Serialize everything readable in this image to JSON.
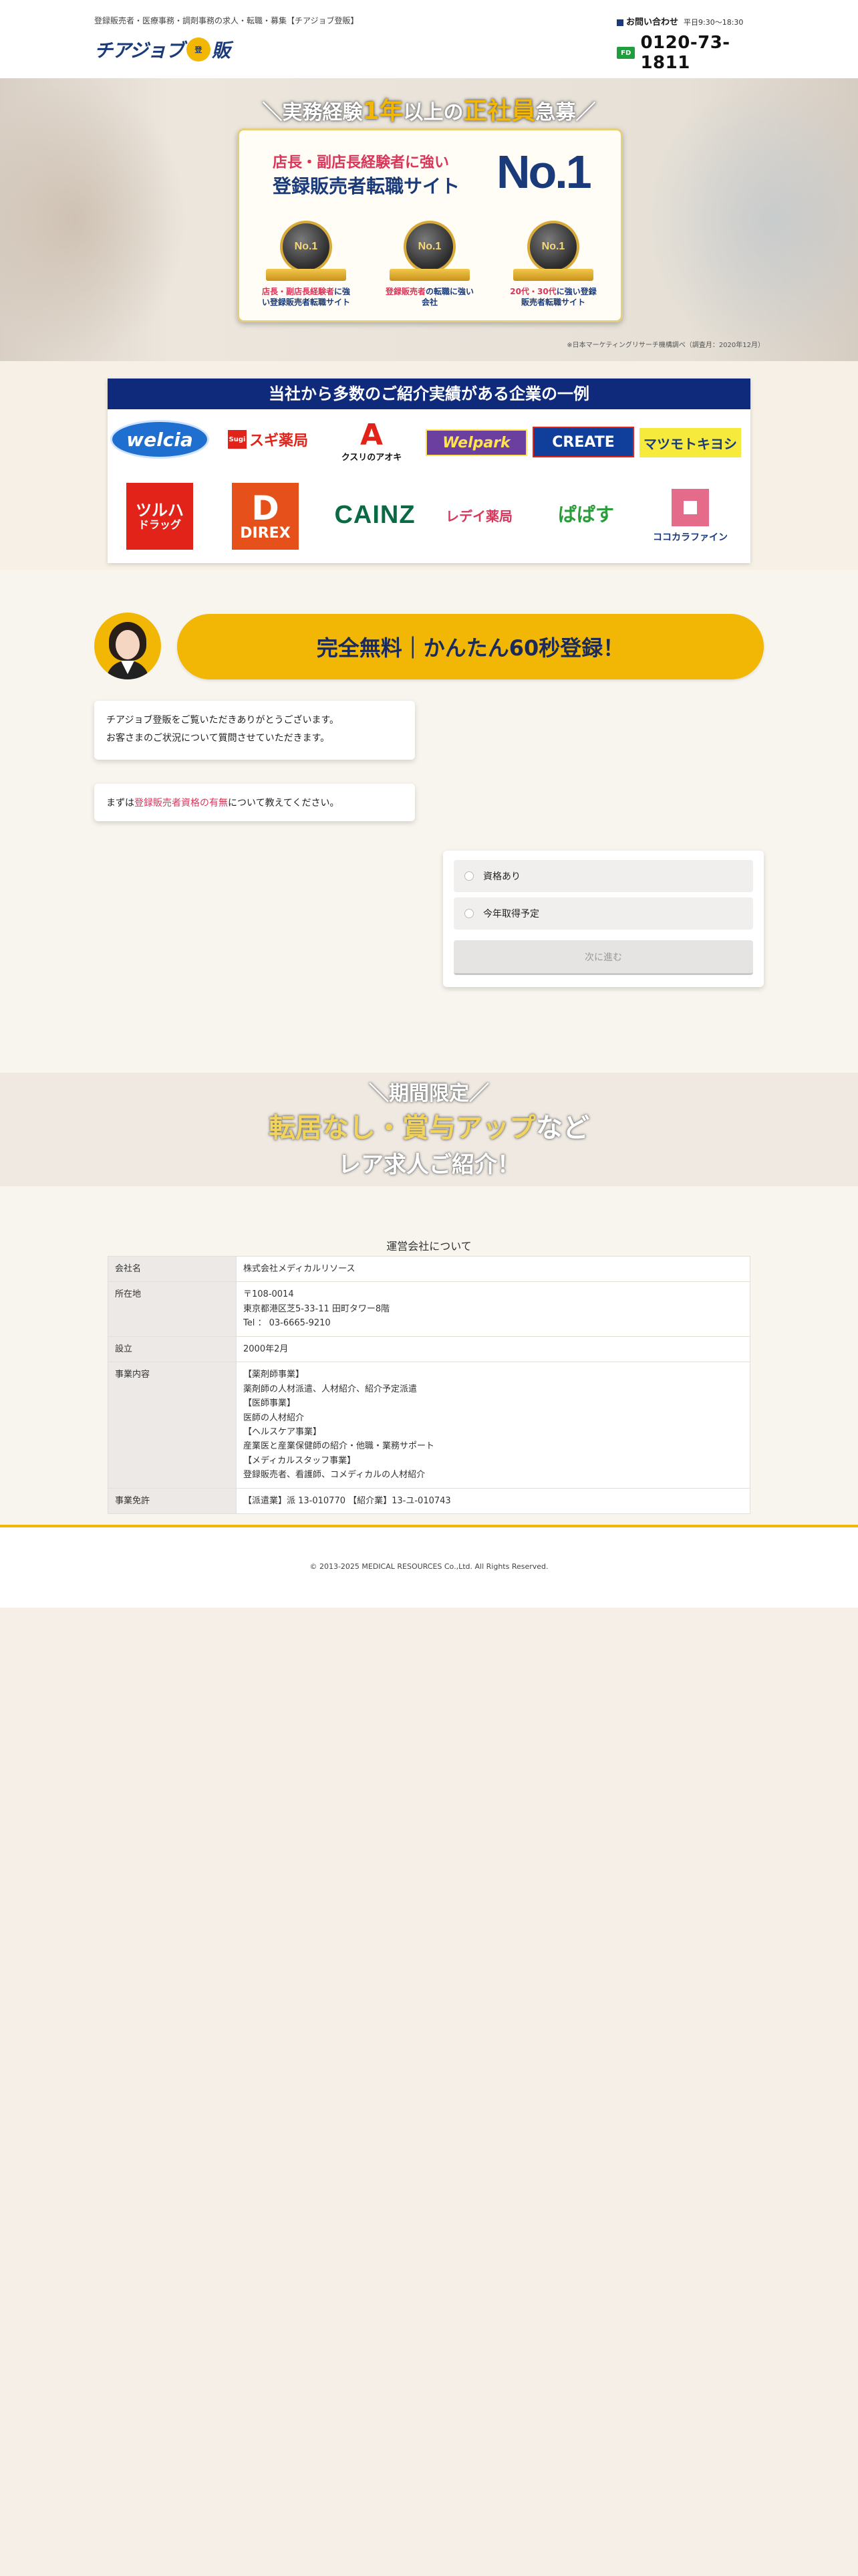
{
  "header": {
    "tagline": "登録販売者・医療事務・調剤事務の求人・転職・募集【チアジョブ登販】",
    "logo_text": "チアジョブ",
    "logo_badge": "登",
    "logo_han": "販",
    "contact_title": "お問い合わせ",
    "contact_hours": "平日9:30〜18:30",
    "tel_icon": "FD",
    "tel": "0120-73-1811"
  },
  "hero": {
    "headline_pre": "＼実務経験",
    "headline_hl1": "1年",
    "headline_mid": "以上の",
    "headline_hl2": "正社員",
    "headline_post": "急募／",
    "card_line1": "店長・副店長経験者に強い",
    "card_line2": "登録販売者転職サイト",
    "card_big": "No.1",
    "medals": [
      {
        "label": "No.1",
        "cap_red": "店長・副店長経験者",
        "cap_rest": "に強い登録販売者転職サイト"
      },
      {
        "label": "No.1",
        "cap_red": "登録販売者",
        "cap_rest": "の転職に強い会社"
      },
      {
        "label": "No.1",
        "cap_red": "20代・30代",
        "cap_rest": "に強い登録販売者転職サイト"
      }
    ],
    "note": "※日本マーケティングリサーチ機構調べ（調査月：2020年12月）"
  },
  "companies": {
    "title": "当社から多数のご紹介実績がある企業の一例",
    "logos": {
      "welcia": "welcia",
      "sugi_box": "Sugi",
      "sugi": "スギ薬局",
      "aoki_mark": "A",
      "aoki": "クスリのアオキ",
      "welpark": "Welpark",
      "create": "CREATE",
      "matsukiyo": "マツモトキヨシ",
      "tsuruha_1": "ツルハ",
      "tsuruha_2": "ドラッグ",
      "direx_mark": "D",
      "direx": "DIREX",
      "cainz": "CAINZ",
      "lady": "レデイ薬局",
      "papasu": "ぱぱす",
      "kokokara": "ココカラファイン"
    }
  },
  "chat": {
    "cta": "完全無料｜かんたん60秒登録！",
    "bubble1_line1": "チアジョブ登販をご覧いただきありがとうございます。",
    "bubble1_line2": "お客さまのご状況について質問させていただきます。",
    "bubble2_pre": "まずは",
    "bubble2_pink": "登録販売者資格の有無",
    "bubble2_post": "について教えてください。",
    "options": [
      "資格あり",
      "今年取得予定"
    ],
    "next": "次に進む"
  },
  "limited": {
    "line1": "＼期間限定／",
    "line2_hl": "転居なし・賞与アップ",
    "line2_post": "など",
    "line3": "レア求人ご紹介！"
  },
  "company_info": {
    "title": "運営会社について",
    "rows": {
      "name_k": "会社名",
      "name_v": "株式会社メディカルリソース",
      "addr_k": "所在地",
      "addr_v1": "〒108-0014",
      "addr_v2": "東京都港区芝5-33-11 田町タワー8階",
      "addr_v3": "Tel ： 03-6665-9210",
      "est_k": "設立",
      "est_v": "2000年2月",
      "biz_k": "事業内容",
      "biz_v1": "【薬剤師事業】",
      "biz_v2": "薬剤師の人材派遣、人材紹介、紹介予定派遣",
      "biz_v3": "【医師事業】",
      "biz_v4": "医師の人材紹介",
      "biz_v5": "【ヘルスケア事業】",
      "biz_v6": "産業医と産業保健師の紹介・他職・業務サポート",
      "biz_v7": "【メディカルスタッフ事業】",
      "biz_v8": "登録販売者、看護師、コメディカルの人材紹介",
      "lic_k": "事業免許",
      "lic_v": "【派遣業】派 13-010770 【紹介業】13-ユ-010743"
    }
  },
  "footer": {
    "copyright": "© 2013-2025 MEDICAL RESOURCES Co.,Ltd. All Rights Reserved."
  }
}
